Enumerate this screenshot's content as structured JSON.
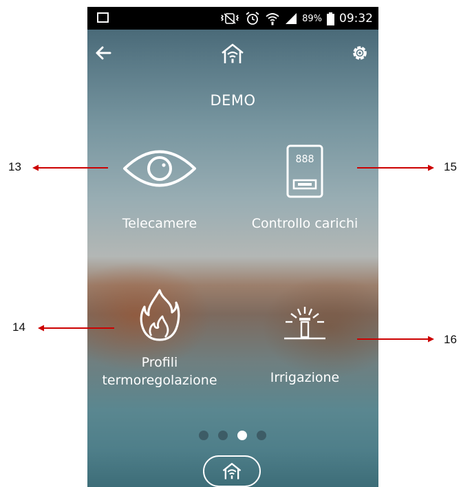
{
  "status_bar": {
    "battery": "89%",
    "time": "09:32"
  },
  "app_bar": {
    "back_icon": "arrow-left-icon",
    "home_icon": "home-wifi-icon",
    "settings_icon": "gear-icon"
  },
  "page": {
    "title": "DEMO"
  },
  "tiles": [
    {
      "label": "Telecamere",
      "icon": "eye-icon"
    },
    {
      "label": "Controllo carichi",
      "icon": "load-meter-icon"
    },
    {
      "label_line1": "Profili",
      "label_line2": "termoregolazione",
      "icon": "flame-icon"
    },
    {
      "label": "Irrigazione",
      "icon": "sprinkler-icon"
    }
  ],
  "pager": {
    "count": 4,
    "active_index": 2
  },
  "annotations": [
    {
      "label": "13",
      "color": "#cc0000"
    },
    {
      "label": "15",
      "color": "#cc0000"
    },
    {
      "label": "14",
      "color": "#cc0000"
    },
    {
      "label": "16",
      "color": "#cc0000"
    }
  ],
  "meter_display": "888"
}
